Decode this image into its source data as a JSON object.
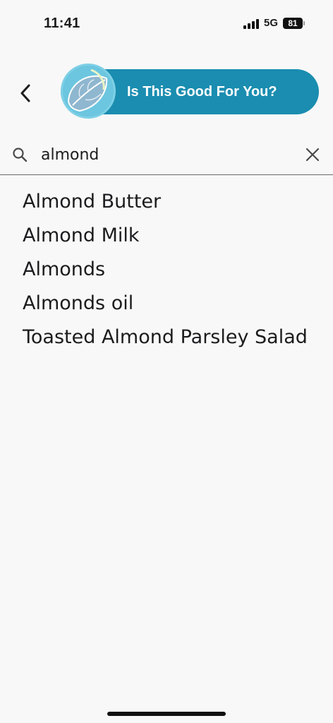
{
  "status_bar": {
    "time": "11:41",
    "network": "5G",
    "battery": "81"
  },
  "header": {
    "title": "Is This Good For You?",
    "brand_color": "#1a8db0"
  },
  "search": {
    "value": "almond",
    "placeholder": ""
  },
  "results": [
    "Almond Butter",
    "Almond Milk",
    "Almonds",
    "Almonds oil",
    "Toasted Almond Parsley Salad"
  ],
  "icons": {
    "back": "chevron-left-icon",
    "search": "search-icon",
    "clear": "close-icon"
  }
}
